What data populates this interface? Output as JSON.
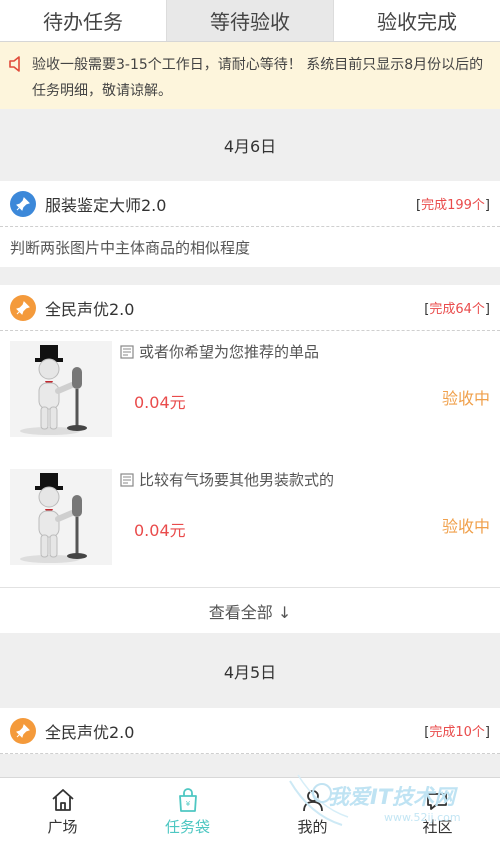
{
  "tabs": [
    "待办任务",
    "等待验收",
    "验收完成"
  ],
  "notice": "验收一般需要3-15个工作日，请耐心等待！ 系统目前只显示8月份以后的任务明细，敬请谅解。",
  "groups": [
    {
      "date": "4月6日",
      "tasks": [
        {
          "title": "服装鉴定大师2.0",
          "done_prefix": "[",
          "done_text": "完成199个",
          "done_suffix": "]",
          "desc": "判断两张图片中主体商品的相似程度"
        },
        {
          "title": "全民声优2.0",
          "done_prefix": "[",
          "done_text": "完成64个",
          "done_suffix": "]",
          "items": [
            {
              "title": "或者你希望为您推荐的单品",
              "price": "0.04元",
              "state": "验收中"
            },
            {
              "title": "比较有气场要其他男装款式的",
              "price": "0.04元",
              "state": "验收中"
            }
          ],
          "view_all": "查看全部 ↓"
        }
      ]
    },
    {
      "date": "4月5日",
      "tasks": [
        {
          "title": "全民声优2.0",
          "done_prefix": "[",
          "done_text": "完成10个",
          "done_suffix": "]"
        }
      ]
    }
  ],
  "nav": [
    "广场",
    "任务袋",
    "我的",
    "社区"
  ],
  "watermark": {
    "text": "我爱IT技术网",
    "url": "www.52ij.com"
  },
  "colors": {
    "accent": "#4ec7c2",
    "price": "#e94b4b",
    "state": "#f0a04b",
    "notice_bg": "#fdf5dc"
  }
}
